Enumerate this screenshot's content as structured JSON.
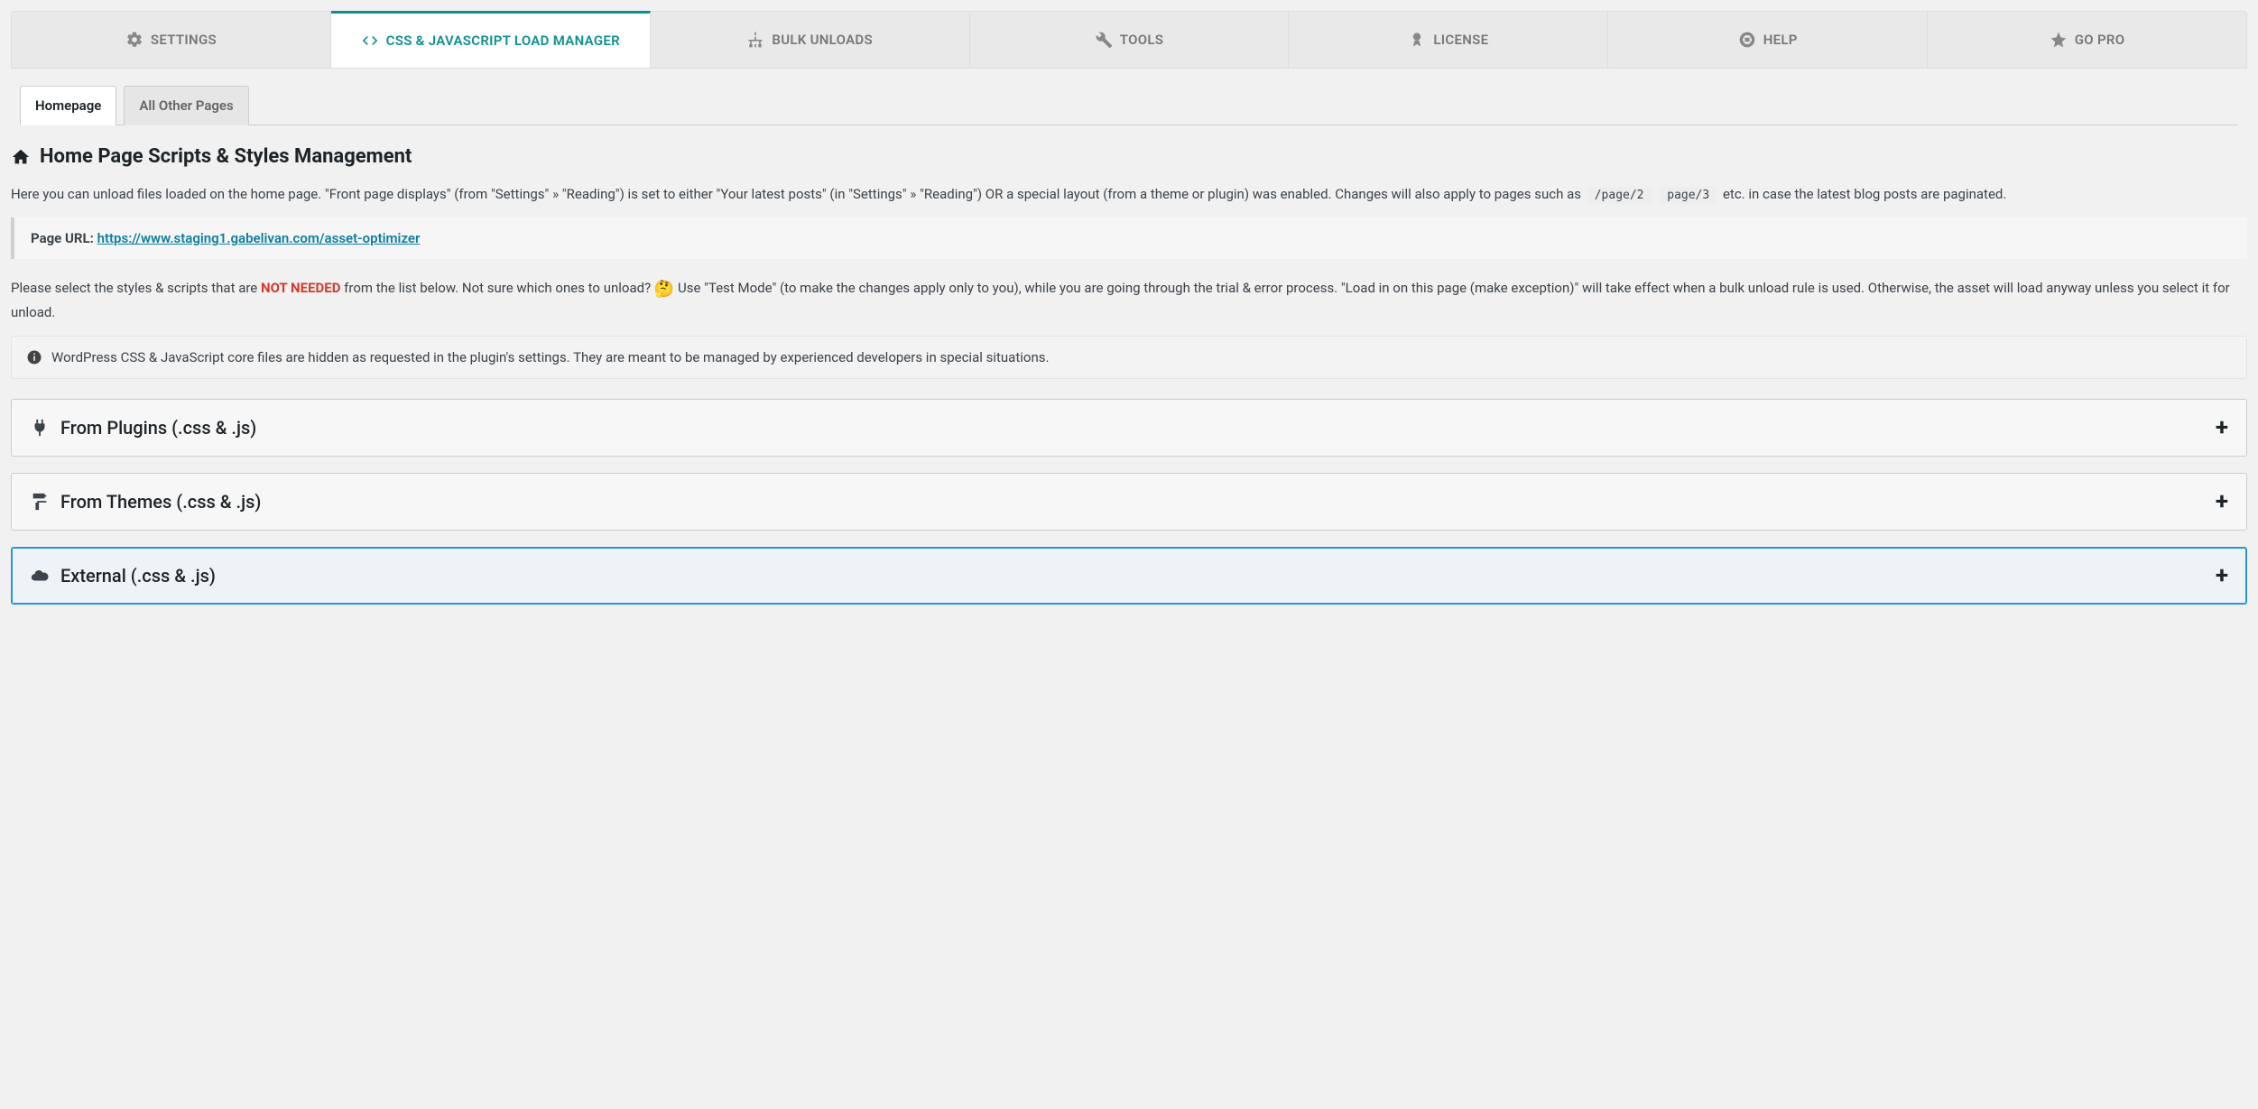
{
  "main_tabs": {
    "settings": "SETTINGS",
    "load_manager": "CSS & JAVASCRIPT LOAD MANAGER",
    "bulk_unloads": "BULK UNLOADS",
    "tools": "TOOLS",
    "license": "LICENSE",
    "help": "HELP",
    "go_pro": "GO PRO"
  },
  "sub_tabs": {
    "homepage": "Homepage",
    "all_other": "All Other Pages"
  },
  "heading": "Home Page Scripts & Styles Management",
  "desc": {
    "p1_a": "Here you can unload files loaded on the home page. \"Front page displays\" (from \"Settings\" » \"Reading\") is set to either \"Your latest posts\" (in \"Settings\" » \"Reading\") OR a special layout (from a theme or plugin) was enabled. Changes will also apply to pages such as",
    "code1": "/page/2",
    "code2": "page/3",
    "p1_b": "etc. in case the latest blog posts are paginated."
  },
  "page_url_label": "Page URL:",
  "page_url": "https://www.staging1.gabelivan.com/asset-optimizer",
  "desc2": {
    "a": "Please select the styles & scripts that are ",
    "not_needed": "NOT NEEDED",
    "b": " from the list below. Not sure which ones to unload? ",
    "emoji": "🤔",
    "c": " Use \"Test Mode\" (to make the changes apply only to you), while you are going through the trial & error process. \"Load in on this page (make exception)\" will take effect when a bulk unload rule is used. Otherwise, the asset will load anyway unless you select it for unload."
  },
  "info_text": "WordPress CSS & JavaScript core files are hidden as requested in the plugin's settings. They are meant to be managed by experienced developers in special situations.",
  "accordions": {
    "plugins": "From Plugins (.css & .js)",
    "themes": "From Themes (.css & .js)",
    "external": "External (.css & .js)"
  }
}
